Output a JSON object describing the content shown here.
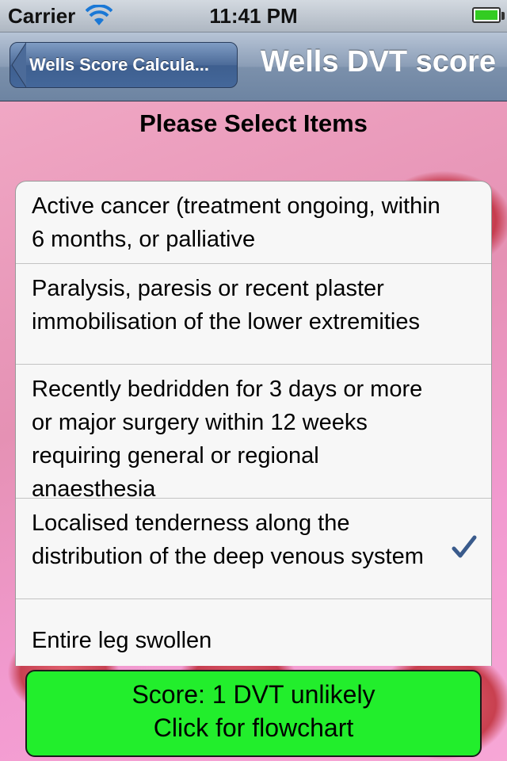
{
  "status_bar": {
    "carrier": "Carrier",
    "time": "11:41 PM",
    "battery_level": 1.0
  },
  "nav": {
    "back_label": "Wells Score Calcula...",
    "title": "Wells DVT score"
  },
  "heading": "Please Select Items",
  "items": [
    {
      "label": "Active cancer (treatment ongoing, within 6 months, or palliative",
      "checked": false
    },
    {
      "label": "Paralysis, paresis or recent plaster immobilisation of the lower extremities",
      "checked": false
    },
    {
      "label": "Recently bedridden for 3 days or more or major surgery within 12 weeks requiring general or regional anaesthesia",
      "checked": false
    },
    {
      "label": "Localised tenderness along the distribution of the deep venous system",
      "checked": true,
      "check_icon": "checkmark-icon"
    },
    {
      "label": "Entire leg swollen",
      "checked": false
    }
  ],
  "score_button": {
    "line1": "Score: 1 DVT unlikely",
    "line2": "Click for flowchart"
  },
  "colors": {
    "score_button_bg": "#22ee2c",
    "checkmark": "#3a5b8c",
    "nav_bar": "#7b90ab"
  }
}
